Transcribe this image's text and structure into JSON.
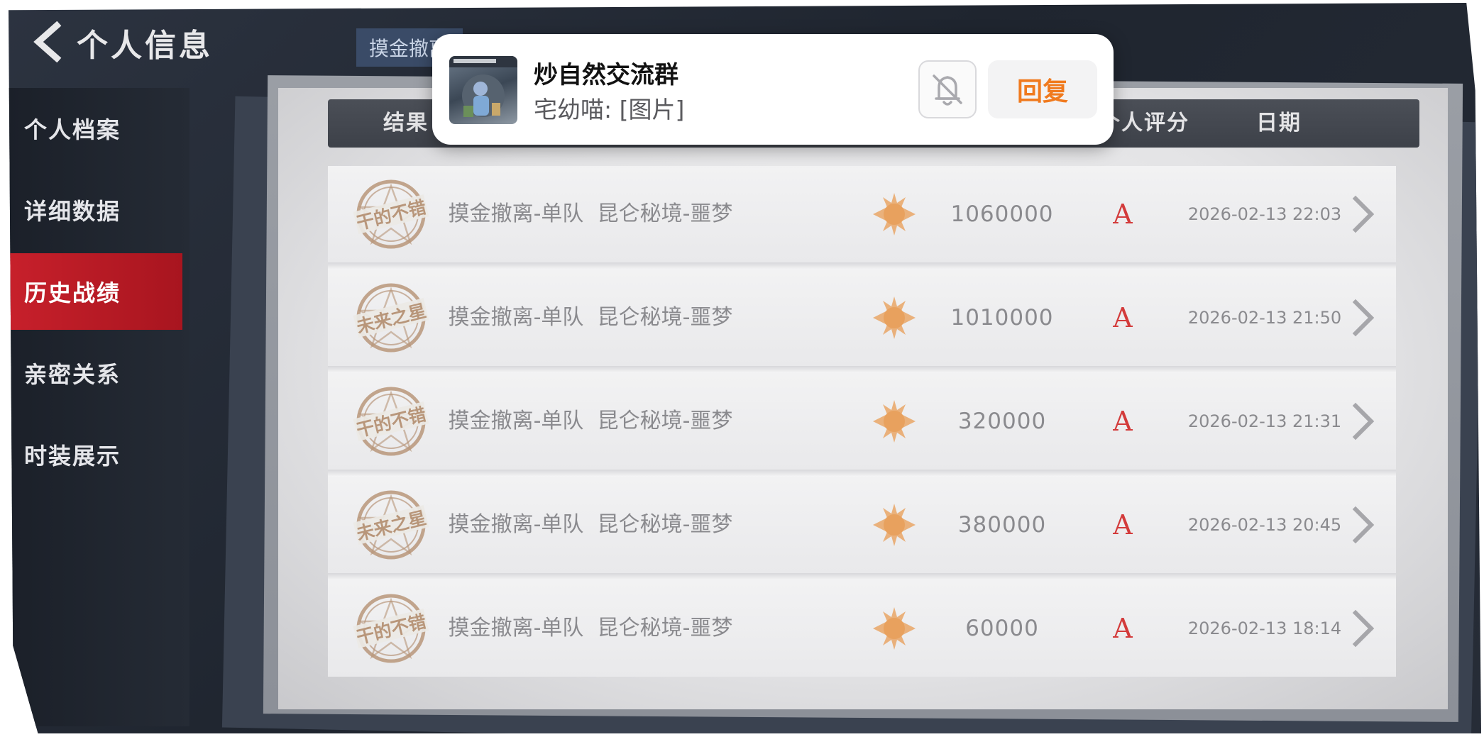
{
  "header": {
    "title": "个人信息",
    "back_icon": "chevron-left-icon"
  },
  "sidebar": {
    "items": [
      {
        "label": "个人档案",
        "active": false
      },
      {
        "label": "详细数据",
        "active": false
      },
      {
        "label": "历史战绩",
        "active": true
      },
      {
        "label": "亲密关系",
        "active": false
      },
      {
        "label": "时装展示",
        "active": false
      }
    ]
  },
  "mode_tab": {
    "label": "摸金撤离"
  },
  "table": {
    "headers": {
      "result": "结果",
      "rating": "个人评分",
      "date": "日期"
    },
    "rows": [
      {
        "badge": "干的不错",
        "mode": "摸金撤离-单队",
        "map": "昆仑秘境-噩梦",
        "value": "1060000",
        "grade": "A",
        "date": "2026-02-13 22:03"
      },
      {
        "badge": "未来之星",
        "mode": "摸金撤离-单队",
        "map": "昆仑秘境-噩梦",
        "value": "1010000",
        "grade": "A",
        "date": "2026-02-13 21:50"
      },
      {
        "badge": "干的不错",
        "mode": "摸金撤离-单队",
        "map": "昆仑秘境-噩梦",
        "value": "320000",
        "grade": "A",
        "date": "2026-02-13 21:31"
      },
      {
        "badge": "未来之星",
        "mode": "摸金撤离-单队",
        "map": "昆仑秘境-噩梦",
        "value": "380000",
        "grade": "A",
        "date": "2026-02-13 20:45"
      },
      {
        "badge": "干的不错",
        "mode": "摸金撤离-单队",
        "map": "昆仑秘境-噩梦",
        "value": "60000",
        "grade": "A",
        "date": "2026-02-13 18:14"
      }
    ]
  },
  "notification": {
    "title": "炒自然交流群",
    "message": "宅幼喵: [图片]",
    "mute_icon": "bell-off-icon",
    "reply_label": "回复"
  },
  "colors": {
    "accent_red": "#c7202b",
    "grade_red": "#d33b3b",
    "sun_orange": "#e8a15e",
    "reply_orange": "#f07a1e",
    "stamp_brown": "#b8967a"
  }
}
